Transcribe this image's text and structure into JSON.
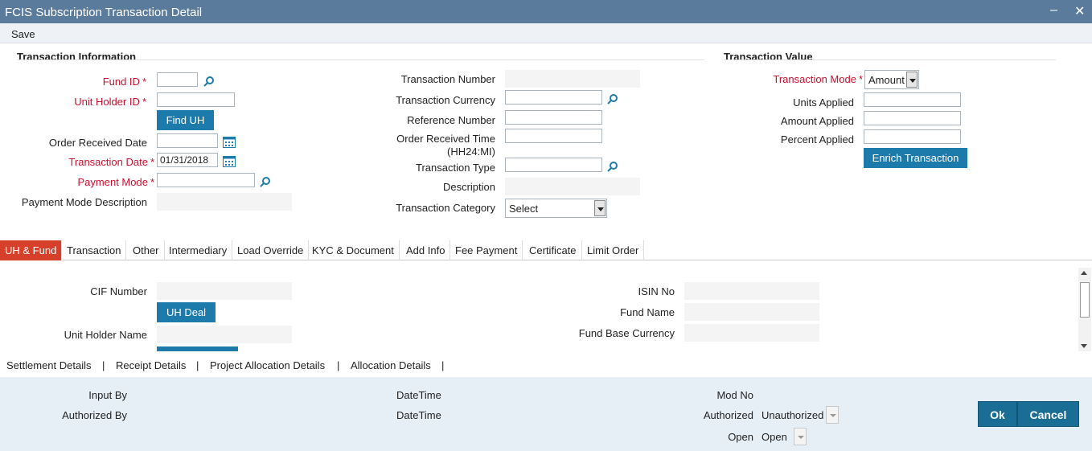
{
  "window": {
    "title": "FCIS Subscription Transaction Detail",
    "minimize": "–",
    "close": "✕"
  },
  "menu": {
    "save": "Save"
  },
  "transaction_info": {
    "title": "Transaction Information",
    "fund_id": "Fund ID",
    "unit_holder_id": "Unit Holder ID",
    "find_uh": "Find UH",
    "order_received_date": "Order Received Date",
    "transaction_date": "Transaction Date",
    "transaction_date_value": "01/31/2018",
    "payment_mode": "Payment Mode",
    "payment_mode_description": "Payment Mode Description",
    "transaction_number": "Transaction Number",
    "transaction_currency": "Transaction Currency",
    "reference_number": "Reference Number",
    "order_received_time_1": "Order Received Time",
    "order_received_time_2": "(HH24:MI)",
    "transaction_type": "Transaction Type",
    "description": "Description",
    "transaction_category": "Transaction Category",
    "transaction_category_value": "Select",
    "required_mark": "*"
  },
  "transaction_value": {
    "title": "Transaction Value",
    "transaction_mode": "Transaction Mode",
    "transaction_mode_value": "Amount",
    "units_applied": "Units Applied",
    "amount_applied": "Amount Applied",
    "percent_applied": "Percent Applied",
    "enrich": "Enrich Transaction"
  },
  "tabs": [
    "UH & Fund",
    "Transaction",
    "Other",
    "Intermediary",
    "Load Override",
    "KYC & Document",
    "Add Info",
    "Fee Payment",
    "Certificate",
    "Limit Order"
  ],
  "uh_fund": {
    "cif_number": "CIF Number",
    "uh_deal": "UH Deal",
    "unit_holder_name": "Unit Holder Name",
    "isin_no": "ISIN No",
    "fund_name": "Fund Name",
    "fund_base_currency": "Fund Base Currency"
  },
  "subtabs": [
    "Settlement Details",
    "Receipt Details",
    "Project Allocation Details",
    "Allocation Details"
  ],
  "subtab_separator": "|",
  "footer": {
    "input_by": "Input By",
    "authorized_by": "Authorized By",
    "datetime_1": "DateTime",
    "datetime_2": "DateTime",
    "mod_no": "Mod No",
    "authorized": "Authorized",
    "authorized_value": "Unauthorized",
    "open": "Open",
    "open_value": "Open",
    "ok": "Ok",
    "cancel": "Cancel"
  },
  "colors": {
    "titlebar": "#5a7b9b",
    "button": "#1d7bac",
    "active_tab": "#d6402a",
    "required": "#c8102e",
    "footer": "#e6eff5"
  }
}
